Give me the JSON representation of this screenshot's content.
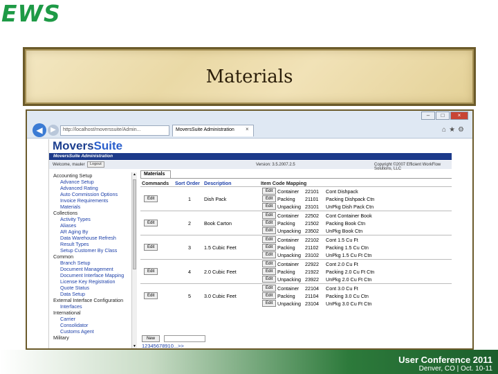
{
  "slide": {
    "logo": "EWS",
    "title": "Materials",
    "footer_line1": "User Conference 2011",
    "footer_line2": "Denver, CO | Oct. 10-11"
  },
  "browser": {
    "address": "http://localhost/moverssuite/Admin...",
    "tab_title": "MoversSuite Administration",
    "tab_close": "×",
    "window_controls": [
      "–",
      "□",
      "×"
    ],
    "tools_icons": [
      "home-icon",
      "star-icon",
      "gear-icon"
    ]
  },
  "app": {
    "logo_movers": "Movers",
    "logo_suite": "Suite",
    "header": "MoversSuite Administration",
    "welcome": "Welcome, mauler",
    "logout_label": "Logout",
    "version": "Version: 3.5.2007.2.5",
    "copyright": "Copyright ©2007 Efficient WorkFlow Solutions, LLC"
  },
  "sidebar": [
    {
      "type": "cat",
      "label": "Accounting Setup"
    },
    {
      "type": "item",
      "label": "Advance Setup"
    },
    {
      "type": "item",
      "label": "Advanced Rating"
    },
    {
      "type": "item",
      "label": "Auto Commission Options"
    },
    {
      "type": "item",
      "label": "Invoice Requirements"
    },
    {
      "type": "item",
      "label": "Materials"
    },
    {
      "type": "cat",
      "label": "Collections"
    },
    {
      "type": "item",
      "label": "Activity Types"
    },
    {
      "type": "item",
      "label": "Aliases"
    },
    {
      "type": "item",
      "label": "AR Aging By"
    },
    {
      "type": "item",
      "label": "Data Warehouse Refresh"
    },
    {
      "type": "item",
      "label": "Result Types"
    },
    {
      "type": "item",
      "label": "Setup Customer By Class"
    },
    {
      "type": "cat",
      "label": "Common"
    },
    {
      "type": "item",
      "label": "Branch Setup"
    },
    {
      "type": "item",
      "label": "Document Management"
    },
    {
      "type": "item",
      "label": "Document Interface Mapping"
    },
    {
      "type": "item",
      "label": "License Key Registration"
    },
    {
      "type": "item",
      "label": "Quote Status"
    },
    {
      "type": "item",
      "label": "Data Setup"
    },
    {
      "type": "cat",
      "label": "External Interface Configuration"
    },
    {
      "type": "item",
      "label": "Interfaces"
    },
    {
      "type": "cat",
      "label": "International"
    },
    {
      "type": "item",
      "label": "Carrier"
    },
    {
      "type": "item",
      "label": "Consolidator"
    },
    {
      "type": "item",
      "label": "Customs Agent"
    },
    {
      "type": "cat",
      "label": "Military"
    }
  ],
  "content": {
    "tab": "Materials",
    "headers": {
      "commands": "Commands",
      "sort_order": "Sort Order",
      "description": "Description",
      "mapping": "Item Code Mapping"
    },
    "edit_label": "Edit",
    "new_label": "New",
    "pager": "12345678910...>>",
    "rows": [
      {
        "sort": "1",
        "desc": "Dish Pack",
        "mappings": [
          {
            "type": "Container",
            "code": "22101",
            "desc": "Cont Dishpack"
          },
          {
            "type": "Packing",
            "code": "21101",
            "desc": "Packing Dishpack Ctn"
          },
          {
            "type": "Unpacking",
            "code": "23101",
            "desc": "UnPkg Dish Pack Ctn"
          }
        ]
      },
      {
        "sort": "2",
        "desc": "Book Carton",
        "mappings": [
          {
            "type": "Container",
            "code": "22502",
            "desc": "Cont Container Book"
          },
          {
            "type": "Packing",
            "code": "21502",
            "desc": "Packing Book Ctn"
          },
          {
            "type": "Unpacking",
            "code": "23502",
            "desc": "UnPkg Book Ctn"
          }
        ]
      },
      {
        "sort": "3",
        "desc": "1.5 Cubic Feet",
        "mappings": [
          {
            "type": "Container",
            "code": "22102",
            "desc": "Cont 1.5 Cu Ft"
          },
          {
            "type": "Packing",
            "code": "21102",
            "desc": "Packing 1.5 Cu Ctn"
          },
          {
            "type": "Unpacking",
            "code": "23102",
            "desc": "UnPkg 1.5 Cu Ft Ctn"
          }
        ]
      },
      {
        "sort": "4",
        "desc": "2.0 Cubic Feet",
        "mappings": [
          {
            "type": "Container",
            "code": "22922",
            "desc": "Cont 2.0 Cu Ft"
          },
          {
            "type": "Packing",
            "code": "21922",
            "desc": "Packing 2.0 Cu Ft Ctn"
          },
          {
            "type": "Unpacking",
            "code": "23922",
            "desc": "UnPkg 2.0 Cu Ft Ctn"
          }
        ]
      },
      {
        "sort": "5",
        "desc": "3.0 Cubic Feet",
        "mappings": [
          {
            "type": "Container",
            "code": "22104",
            "desc": "Cont 3.0 Cu Ft"
          },
          {
            "type": "Packing",
            "code": "21104",
            "desc": "Packing 3.0 Cu Ctn"
          },
          {
            "type": "Unpacking",
            "code": "23104",
            "desc": "UnPkg 3.0 Cu Ft Ctn"
          }
        ]
      }
    ]
  }
}
